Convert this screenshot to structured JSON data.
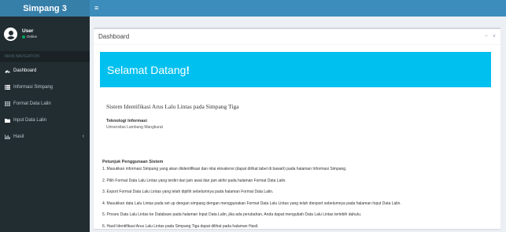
{
  "app": {
    "title": "Simpang 3"
  },
  "user": {
    "name": "User",
    "status": "Online"
  },
  "sidebar": {
    "header": "MAIN NAVIGATION",
    "items": [
      {
        "label": "Dashboard",
        "icon": "dashboard-icon",
        "active": true
      },
      {
        "label": "Informasi Simpang",
        "icon": "list-icon"
      },
      {
        "label": "Format Data Lalin",
        "icon": "table-icon"
      },
      {
        "label": "Input Data Lalin",
        "icon": "folder-icon"
      },
      {
        "label": "Hasil",
        "icon": "bar-chart-icon",
        "chevron": "‹"
      }
    ]
  },
  "box": {
    "title": "Dashboard",
    "tools": {
      "collapse": "−",
      "close": "×"
    }
  },
  "banner": {
    "text": "Selamat Datang",
    "mark": "!"
  },
  "system": {
    "title": "Sistem Identifikasi Arus Lalu Lintas pada Simpang Tiga"
  },
  "org": {
    "name": "Teknologi Informasi",
    "university": "Universitas Lambung Mangkurat"
  },
  "guide": {
    "title": "Petunjuk Penggunaan Sistem",
    "steps": [
      "1. Masukkan informasi Simpang yang akan diidentifikasi dan nilai ekivalensi (dapat dilihat tabel di bawah) pada halaman Informasi Simpang.",
      "2. Pilih Format Data Lalu Lintas yang terdiri dari jam awal dan jam akhir pada halaman Format Data Lalin.",
      "3. Export Format Data Lalu Lintas yang telah dipilih sebelumnya pada halaman Format Data Lalin.",
      "4. Masukkan data Lalu Lintas pada set up dengan simpang dengan menggunakan Format Data Lalu Lintas yang telah diexport sebelumnya pada halaman Input Data Lalin.",
      "5. Proses Data Lalu Lintas ke Database pada halaman Input Data Lalin, jika ada perubahan, Anda dapat mengubah Data Lalu Lintas terlebih dahulu.",
      "6. Hasil Identifikasi Arus Lalu Lintas pada Simpang Tiga dapat dilihat pada halaman Hasil."
    ]
  },
  "colors": {
    "header": "#3c8dbc",
    "logo": "#367fa9",
    "sidebar": "#222d32",
    "banner": "#00c0ef",
    "online": "#00a65a"
  }
}
